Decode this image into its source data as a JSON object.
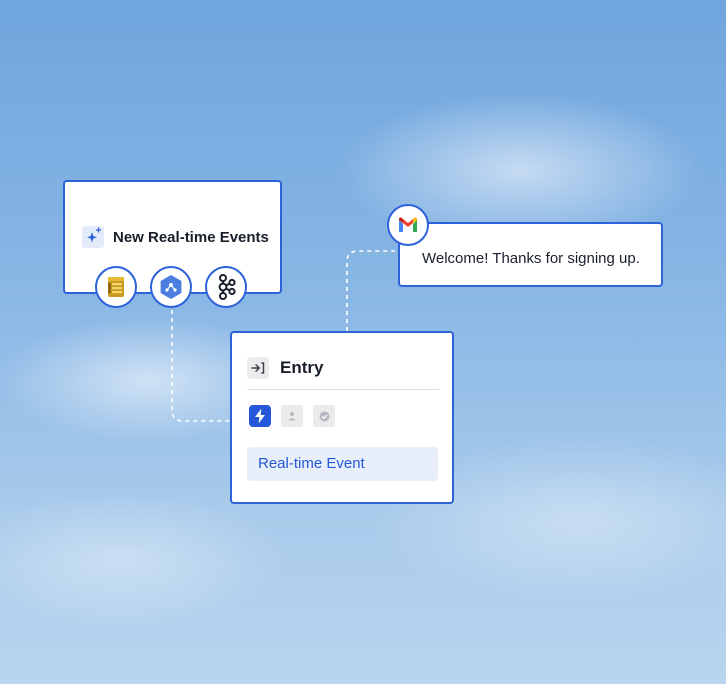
{
  "trigger": {
    "title": "New Real-time Events",
    "sources": [
      "aws-icon",
      "gcp-icon",
      "kafka-icon"
    ]
  },
  "message": {
    "text": "Welcome! Thanks for signing up.",
    "channel_icon": "gmail-icon"
  },
  "entry": {
    "title": "Entry",
    "states": [
      "lightning-icon",
      "user-icon",
      "check-icon"
    ],
    "event_label": "Real-time Event"
  },
  "colors": {
    "accent": "#2e62d9",
    "pill_bg": "#e8effb",
    "pill_text": "#2558d8"
  }
}
